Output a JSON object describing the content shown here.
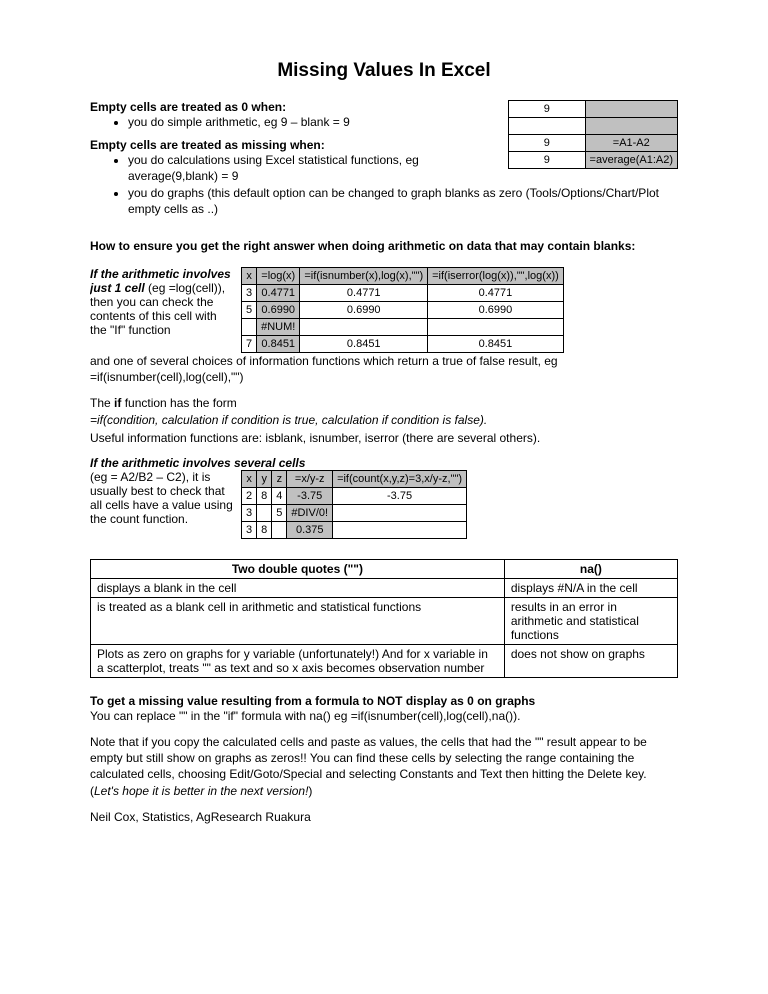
{
  "title": "Missing Values In Excel",
  "section1": {
    "heading": "Empty cells are treated as 0 when:",
    "bullet1": "you do simple arithmetic, eg 9 – blank = 9"
  },
  "section2": {
    "heading": "Empty cells are treated as missing when:",
    "bullet1": "you do calculations using Excel statistical functions, eg average(9,blank) = 9",
    "bullet2": "you do graphs (this default option can be changed to graph blanks as zero (Tools/Options/Chart/Plot empty cells as ..)"
  },
  "miniTable": {
    "r1c1": "9",
    "r1c2": "",
    "r2c1": "",
    "r2c2": "",
    "r3c1": "9",
    "r3c2": "=A1-A2",
    "r4c1": "9",
    "r4c2": "=average(A1:A2)"
  },
  "section3": {
    "heading": "How to ensure you get the right answer when doing arithmetic on data that may contain blanks:"
  },
  "oneCell": {
    "introBoldItalic": "If the arithmetic involves just 1 cell",
    "introRest": " (eg =log(cell)), then you can check the contents of this cell with the \"If\" function",
    "para2a": "and one of several choices of information functions which return a true of false result, eg ",
    "para2b": "=if(isnumber(cell),log(cell),\"\")",
    "para3a": "The ",
    "para3b": "if",
    "para3c": " function has the form",
    "para4": "=if(condition, calculation if condition is true, calculation if condition is false).",
    "para5": "Useful information functions are: isblank, isnumber, iserror (there are several others)."
  },
  "table1": {
    "h1": "x",
    "h2": "=log(x)",
    "h3": "=if(isnumber(x),log(x),\"\")",
    "h4": "=if(iserror(log(x)),\"\",log(x))",
    "rows": [
      {
        "c1": "3",
        "c2": "0.4771",
        "c3": "0.4771",
        "c4": "0.4771"
      },
      {
        "c1": "5",
        "c2": "0.6990",
        "c3": "0.6990",
        "c4": "0.6990"
      },
      {
        "c1": "",
        "c2": "#NUM!",
        "c3": "",
        "c4": ""
      },
      {
        "c1": "7",
        "c2": "0.8451",
        "c3": "0.8451",
        "c4": "0.8451"
      }
    ]
  },
  "multiCell": {
    "heading": "If the arithmetic involves several cells",
    "intro": " (eg = A2/B2 – C2), it is usually best to check that all cells have a value using the count function."
  },
  "table2": {
    "h1": "x",
    "h2": "y",
    "h3": "z",
    "h4": "=x/y-z",
    "h5": "=if(count(x,y,z)=3,x/y-z,\"\")",
    "rows": [
      {
        "c1": "2",
        "c2": "8",
        "c3": "4",
        "c4": "-3.75",
        "c5": "-3.75"
      },
      {
        "c1": "3",
        "c2": "",
        "c3": "5",
        "c4": "#DIV/0!",
        "c5": ""
      },
      {
        "c1": "3",
        "c2": "8",
        "c3": "",
        "c4": "0.375",
        "c5": ""
      }
    ]
  },
  "compare": {
    "h1": "Two double quotes (\"\")",
    "h2": "na()",
    "rows": [
      {
        "a": "displays a blank in the cell",
        "b": "displays #N/A in the cell"
      },
      {
        "a": "is treated as a blank cell in arithmetic and statistical functions",
        "b": "results in an error in arithmetic and statistical functions"
      },
      {
        "a": "Plots as zero on graphs for y variable (unfortunately!)\nAnd for x variable in a scatterplot, treats \"\" as text and so x axis becomes observation number",
        "b": "does not show on graphs"
      }
    ]
  },
  "final": {
    "heading": "To get a missing value resulting from a formula to NOT display as 0 on graphs",
    "p1": "You can replace \"\" in the \"if\" formula with na() eg =if(isnumber(cell),log(cell),na()).",
    "p2a": "Note that if you copy the calculated cells and paste as values, the cells that had the \"\" result appear to be empty but still show on graphs as zeros!! You can find these cells by selecting the range containing the calculated cells, choosing Edit/Goto/Special and selecting Constants and Text then hitting the Delete key. (",
    "p2b": "Let's hope it is better in the next version!",
    "p2c": ")",
    "author": "Neil Cox, Statistics, AgResearch Ruakura"
  }
}
